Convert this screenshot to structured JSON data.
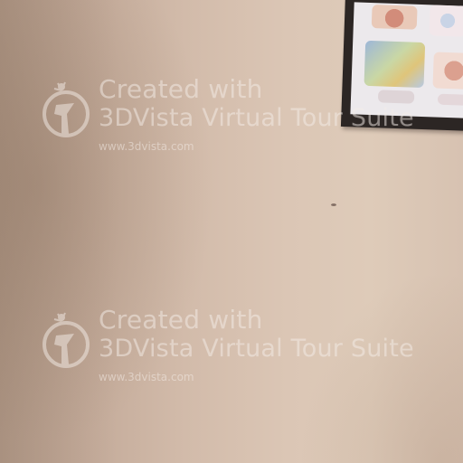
{
  "watermarks": [
    {
      "line1": "Created with",
      "line2": "3DVista Virtual Tour Suite",
      "url": "www.3dvista.com",
      "logo_icon": "3dvista-logo-icon"
    },
    {
      "line1": "Created with",
      "line2": "3DVista Virtual Tour Suite",
      "url": "www.3dvista.com",
      "logo_icon": "3dvista-logo-icon"
    }
  ],
  "colors": {
    "wall": "#d6c1b0",
    "watermark_text": "#f5eee9",
    "frame": "#2c2624"
  }
}
